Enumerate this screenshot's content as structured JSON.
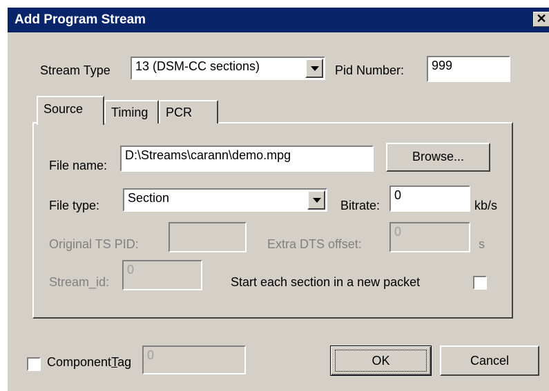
{
  "window": {
    "title": "Add Program Stream",
    "close_symbol": "✕"
  },
  "stream_type": {
    "label": "Stream Type",
    "value": "13 (DSM-CC sections)"
  },
  "pid": {
    "label": "Pid Number:",
    "value": "999"
  },
  "tabs": [
    {
      "label": "Source"
    },
    {
      "label": "Timing"
    },
    {
      "label": "PCR"
    }
  ],
  "source": {
    "file_name_label": "File name:",
    "file_name_value": "D:\\Streams\\carann\\demo.mpg",
    "browse_label": "Browse...",
    "file_type_label": "File type:",
    "file_type_value": "Section",
    "bitrate_label": "Bitrate:",
    "bitrate_value": "0",
    "bitrate_unit": "kb/s",
    "orig_ts_pid_label": "Original TS PID:",
    "orig_ts_pid_value": "",
    "extra_dts_label": "Extra DTS offset:",
    "extra_dts_value": "0",
    "extra_dts_unit": "s",
    "stream_id_label": "Stream_id:",
    "stream_id_value": "0",
    "new_packet_label": "Start each section in a new packet",
    "new_packet_checked": false
  },
  "component_tag": {
    "label_pre": "Component",
    "label_accel": "T",
    "label_post": "ag",
    "value": "0",
    "checked": false
  },
  "buttons": {
    "ok": "OK",
    "cancel": "Cancel"
  }
}
